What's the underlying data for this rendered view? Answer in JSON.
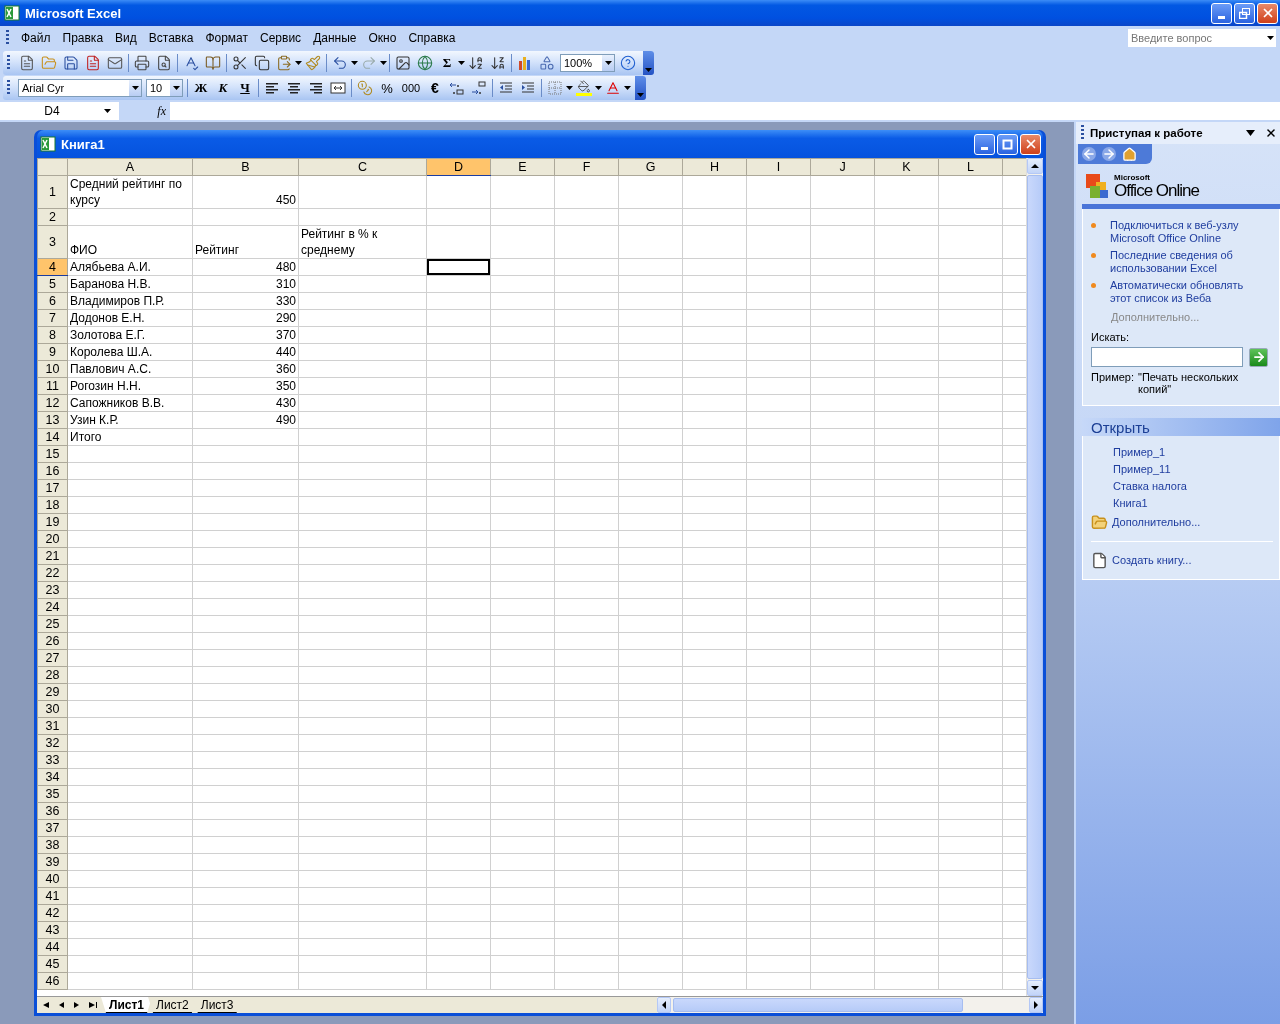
{
  "window": {
    "title": "Microsoft Excel"
  },
  "menu": [
    "Файл",
    "Правка",
    "Вид",
    "Вставка",
    "Формат",
    "Сервис",
    "Данные",
    "Окно",
    "Справка"
  ],
  "help_box": {
    "placeholder": "Введите вопрос"
  },
  "standard_toolbar": {
    "sum": "Σ",
    "zoom": "100%"
  },
  "formatting_toolbar": {
    "font": "Arial Cyr",
    "size": "10",
    "bold": "Ж",
    "italic": "К",
    "underline": "Ч",
    "percent": "%",
    "thousands": "000",
    "euro": "€"
  },
  "formula_bar": {
    "name_box": "D4",
    "function": "fx"
  },
  "workbook": {
    "title": "Книга1",
    "columns": [
      {
        "label": "A",
        "selected": false
      },
      {
        "label": "B",
        "selected": false
      },
      {
        "label": "C",
        "selected": false
      },
      {
        "label": "D",
        "selected": true
      },
      {
        "label": "E",
        "selected": false
      },
      {
        "label": "F",
        "selected": false
      },
      {
        "label": "G",
        "selected": false
      },
      {
        "label": "H",
        "selected": false
      },
      {
        "label": "I",
        "selected": false
      },
      {
        "label": "J",
        "selected": false
      },
      {
        "label": "K",
        "selected": false
      },
      {
        "label": "L",
        "selected": false
      }
    ],
    "rows": [
      {
        "label": "1",
        "selected": false,
        "cells": [
          {
            "kind": "text",
            "text": "Средний рейтинг по курсу"
          },
          {
            "kind": "number",
            "text": "450"
          }
        ]
      },
      {
        "label": "2",
        "selected": false
      },
      {
        "label": "3",
        "selected": false,
        "cells": [
          {
            "kind": "text",
            "text": "ФИО"
          },
          {
            "kind": "text",
            "text": "Рейтинг"
          },
          {
            "kind": "text",
            "text": "Рейтинг в % к среднему"
          }
        ]
      },
      {
        "label": "4",
        "selected": true,
        "cells": [
          {
            "kind": "text",
            "text": "Алябьева А.И."
          },
          {
            "kind": "number",
            "text": "480"
          }
        ]
      },
      {
        "label": "5",
        "selected": false,
        "cells": [
          {
            "kind": "text",
            "text": "Баранова Н.В."
          },
          {
            "kind": "number",
            "text": "310"
          }
        ]
      },
      {
        "label": "6",
        "selected": false,
        "cells": [
          {
            "kind": "text",
            "text": "Владимиров П.Р."
          },
          {
            "kind": "number",
            "text": "330"
          }
        ]
      },
      {
        "label": "7",
        "selected": false,
        "cells": [
          {
            "kind": "text",
            "text": "Додонов Е.Н."
          },
          {
            "kind": "number",
            "text": "290"
          }
        ]
      },
      {
        "label": "8",
        "selected": false,
        "cells": [
          {
            "kind": "text",
            "text": "Золотова Е.Г."
          },
          {
            "kind": "number",
            "text": "370"
          }
        ]
      },
      {
        "label": "9",
        "selected": false,
        "cells": [
          {
            "kind": "text",
            "text": "Королева Ш.А."
          },
          {
            "kind": "number",
            "text": "440"
          }
        ]
      },
      {
        "label": "10",
        "selected": false,
        "cells": [
          {
            "kind": "text",
            "text": "Павлович А.С."
          },
          {
            "kind": "number",
            "text": "360"
          }
        ]
      },
      {
        "label": "11",
        "selected": false,
        "cells": [
          {
            "kind": "text",
            "text": "Рогозин Н.Н."
          },
          {
            "kind": "number",
            "text": "350"
          }
        ]
      },
      {
        "label": "12",
        "selected": false,
        "cells": [
          {
            "kind": "text",
            "text": "Сапожников В.В."
          },
          {
            "kind": "number",
            "text": "430"
          }
        ]
      },
      {
        "label": "13",
        "selected": false,
        "cells": [
          {
            "kind": "text",
            "text": "Узин К.Р."
          },
          {
            "kind": "number",
            "text": "490"
          }
        ]
      },
      {
        "label": "14",
        "selected": false,
        "cells": [
          {
            "kind": "text",
            "text": "Итого"
          }
        ]
      },
      {
        "label": "15",
        "selected": false
      },
      {
        "label": "16",
        "selected": false
      },
      {
        "label": "17",
        "selected": false
      },
      {
        "label": "18",
        "selected": false
      },
      {
        "label": "19",
        "selected": false
      },
      {
        "label": "20",
        "selected": false
      },
      {
        "label": "21",
        "selected": false
      },
      {
        "label": "22",
        "selected": false
      },
      {
        "label": "23",
        "selected": false
      },
      {
        "label": "24",
        "selected": false
      },
      {
        "label": "25",
        "selected": false
      },
      {
        "label": "26",
        "selected": false
      },
      {
        "label": "27",
        "selected": false
      },
      {
        "label": "28",
        "selected": false
      },
      {
        "label": "29",
        "selected": false
      },
      {
        "label": "30",
        "selected": false
      },
      {
        "label": "31",
        "selected": false
      },
      {
        "label": "32",
        "selected": false
      },
      {
        "label": "33",
        "selected": false
      },
      {
        "label": "34",
        "selected": false
      },
      {
        "label": "35",
        "selected": false
      },
      {
        "label": "36",
        "selected": false
      },
      {
        "label": "37",
        "selected": false
      },
      {
        "label": "38",
        "selected": false
      },
      {
        "label": "39",
        "selected": false
      },
      {
        "label": "40",
        "selected": false
      },
      {
        "label": "41",
        "selected": false
      },
      {
        "label": "42",
        "selected": false
      },
      {
        "label": "43",
        "selected": false
      },
      {
        "label": "44",
        "selected": false
      },
      {
        "label": "45",
        "selected": false
      },
      {
        "label": "46",
        "selected": false
      }
    ],
    "sheets": [
      {
        "label": "Лист1",
        "selected": true
      },
      {
        "label": "Лист2",
        "selected": false
      },
      {
        "label": "Лист3",
        "selected": false
      }
    ]
  },
  "task_pane": {
    "title": "Приступая к работе",
    "logo": {
      "brand": "Microsoft",
      "product": "Office Online"
    },
    "links": [
      "Подключиться к веб-узлу Microsoft Office Online",
      "Последние сведения об использовании Excel",
      "Автоматически обновлять этот список из Веба"
    ],
    "more": "Дополнительно...",
    "search": {
      "label": "Искать:",
      "example_label": "Пример:",
      "example": "\"Печать нескольких копий\""
    },
    "open": {
      "title": "Открыть",
      "files": [
        "Пример_1",
        "Пример_11",
        "Ставка налога",
        "Книга1"
      ],
      "more": "Дополнительно...",
      "create": "Создать книгу..."
    }
  }
}
